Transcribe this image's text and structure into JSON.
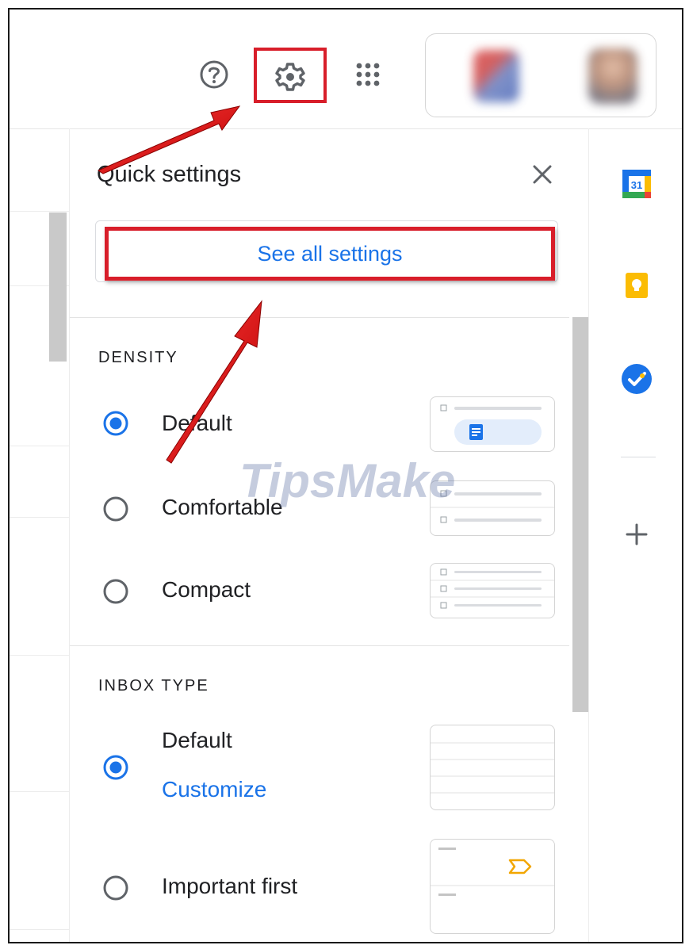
{
  "header": {
    "help_icon": "help-circle-icon",
    "settings_icon": "gear-icon",
    "apps_icon": "apps-grid-icon"
  },
  "quick_settings": {
    "title": "Quick settings",
    "close_icon": "close-icon",
    "see_all_label": "See all settings",
    "density": {
      "heading": "DENSITY",
      "options": [
        {
          "label": "Default",
          "selected": true
        },
        {
          "label": "Comfortable",
          "selected": false
        },
        {
          "label": "Compact",
          "selected": false
        }
      ]
    },
    "inbox_type": {
      "heading": "INBOX TYPE",
      "options": [
        {
          "label": "Default",
          "selected": true,
          "link": "Customize"
        },
        {
          "label": "Important first",
          "selected": false
        }
      ]
    }
  },
  "side_panel": {
    "calendar_label": "31",
    "icons": [
      "calendar-icon",
      "keep-icon",
      "tasks-icon",
      "plus-icon"
    ]
  },
  "watermark": "TipsMake",
  "colors": {
    "accent_blue": "#1a73e8",
    "highlight_red": "#d81e2a",
    "radio_blue": "#1a73e8"
  }
}
